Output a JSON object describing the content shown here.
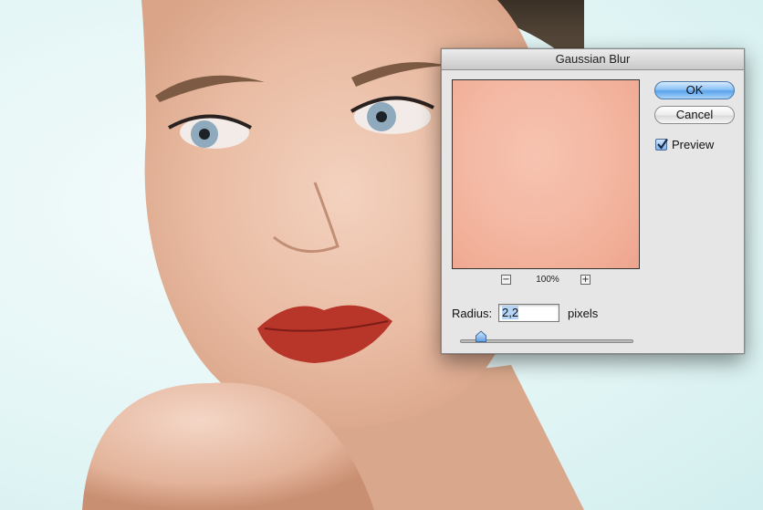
{
  "dialog": {
    "title": "Gaussian Blur",
    "ok_label": "OK",
    "cancel_label": "Cancel",
    "preview_label": "Preview",
    "preview_checked": true,
    "zoom_level": "100%",
    "zoom_minus": "−",
    "zoom_plus": "+",
    "radius_label": "Radius:",
    "radius_value": "2,2",
    "radius_unit": "pixels",
    "slider_fraction": 0.12
  },
  "colors": {
    "ok_button": "#6aaef0",
    "preview_skin": "#f4b9a4",
    "canvas_background": "#e2f5f5"
  },
  "icons": {
    "checkbox": "checkmark-icon",
    "slider": "slider-thumb-icon"
  }
}
